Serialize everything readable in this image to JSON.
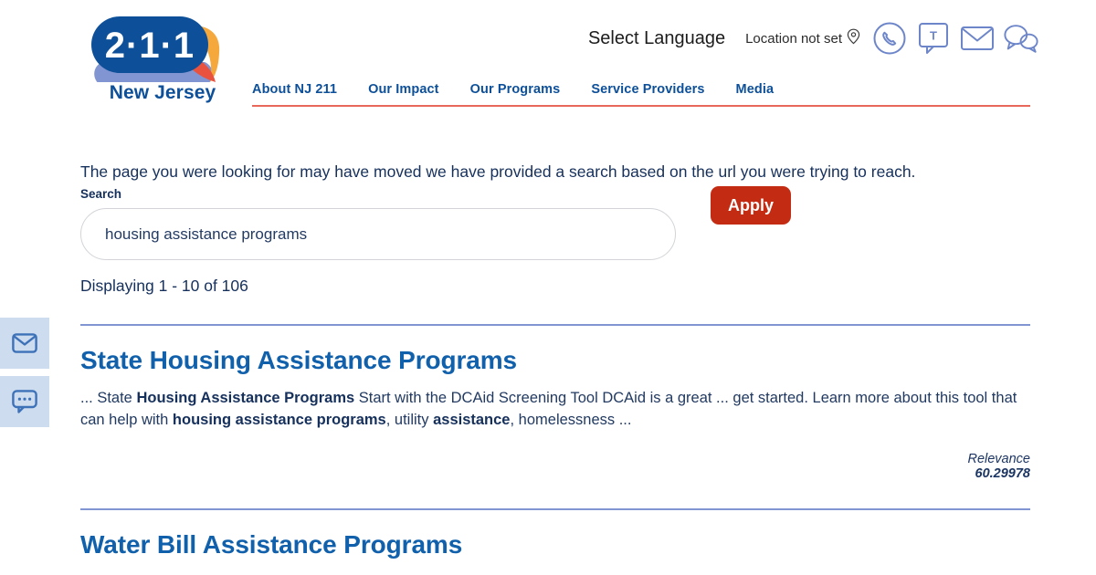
{
  "brand": {
    "logo_digits": "2·1·1",
    "logo_subtitle": "New Jersey",
    "logo_blue": "#0d5099",
    "logo_orange": "#f5a83c",
    "logo_red": "#e8523f",
    "logo_shadow": "#8195d2"
  },
  "utility_bar": {
    "language_label": "Select Language",
    "location_label": "Location not set",
    "location_icon": "map-pin-icon",
    "icons": [
      {
        "name": "phone-circle-icon",
        "title": "Call 211"
      },
      {
        "name": "tty-text-icon",
        "title": "Text 211"
      },
      {
        "name": "email-icon",
        "title": "Email 211"
      },
      {
        "name": "chat-icon",
        "title": "Chat with 211"
      }
    ]
  },
  "nav": {
    "items": [
      {
        "label": "About NJ 211"
      },
      {
        "label": "Our Impact"
      },
      {
        "label": "Our Programs"
      },
      {
        "label": "Service Providers"
      },
      {
        "label": "Media"
      }
    ],
    "underline_color": "#e8685c",
    "link_color": "#0d5099"
  },
  "main": {
    "notice": "The page you were looking for may have moved we have provided a search based on the url you were trying to reach.",
    "search": {
      "label": "Search",
      "value": "housing assistance programs",
      "placeholder": "",
      "apply_label": "Apply",
      "apply_color": "#c32b12"
    },
    "displaying": "Displaying 1 - 10 of 106",
    "results": [
      {
        "title": "State Housing Assistance Programs",
        "snippet_html": "... State <b>Housing Assistance Programs</b> Start with the DCAid Screening Tool DCAid is a great ... get started. Learn more about this tool that can help with <b>housing assistance programs</b>, utility <b>assistance</b>, homelessness ...",
        "relevance_label": "Relevance",
        "relevance_value": "60.29978"
      },
      {
        "title": "Water Bill Assistance Programs",
        "snippet_html": "",
        "relevance_label": "",
        "relevance_value": ""
      }
    ]
  },
  "side_widgets": [
    {
      "name": "email-widget",
      "icon": "envelope-icon"
    },
    {
      "name": "chat-widget",
      "icon": "chat-dots-icon"
    }
  ]
}
